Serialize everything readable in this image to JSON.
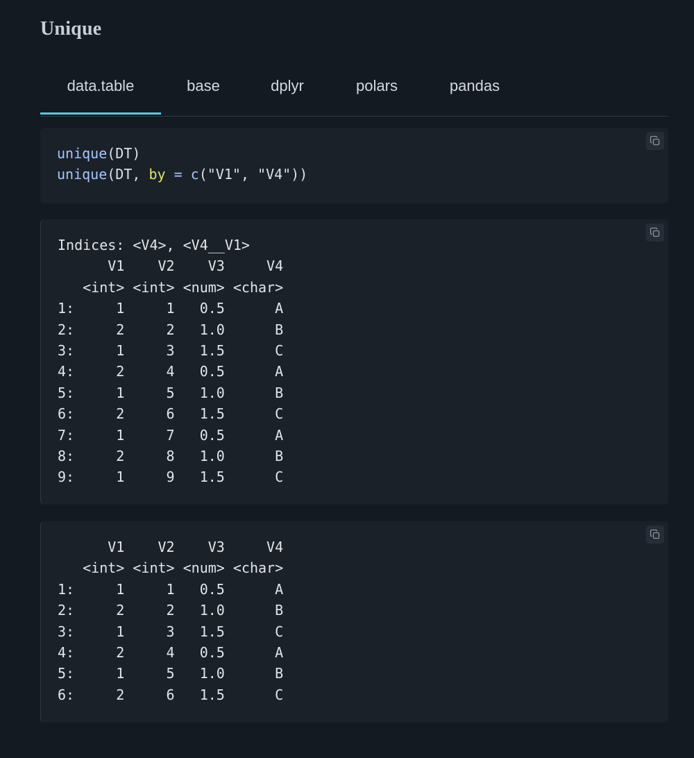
{
  "page": {
    "title": "Unique"
  },
  "tabs": [
    {
      "label": "data.table",
      "active": true
    },
    {
      "label": "base",
      "active": false
    },
    {
      "label": "dplyr",
      "active": false
    },
    {
      "label": "polars",
      "active": false
    },
    {
      "label": "pandas",
      "active": false
    }
  ],
  "code": {
    "line1_fn": "unique",
    "line1_rest": "(DT)",
    "line2_fn": "unique",
    "line2_open": "(DT, ",
    "line2_arg": "by",
    "line2_eq": " = ",
    "line2_c": "c",
    "line2_rest": "(\"V1\", \"V4\"))"
  },
  "output1": {
    "text": "Indices: <V4>, <V4__V1>\n      V1    V2    V3     V4\n   <int> <int> <num> <char>\n1:     1     1   0.5      A\n2:     2     2   1.0      B\n3:     1     3   1.5      C\n4:     2     4   0.5      A\n5:     1     5   1.0      B\n6:     2     6   1.5      C\n7:     1     7   0.5      A\n8:     2     8   1.0      B\n9:     1     9   1.5      C"
  },
  "output2": {
    "text": "      V1    V2    V3     V4\n   <int> <int> <num> <char>\n1:     1     1   0.5      A\n2:     2     2   1.0      B\n3:     1     3   1.5      C\n4:     2     4   0.5      A\n5:     1     5   1.0      B\n6:     2     6   1.5      C"
  },
  "icons": {
    "copy": "copy-icon"
  },
  "colors": {
    "background": "#141a21",
    "code_background": "#1b2129",
    "active_tab_underline": "#5bc7df",
    "function_color": "#a7c5ff",
    "argument_color": "#dbe66b"
  }
}
